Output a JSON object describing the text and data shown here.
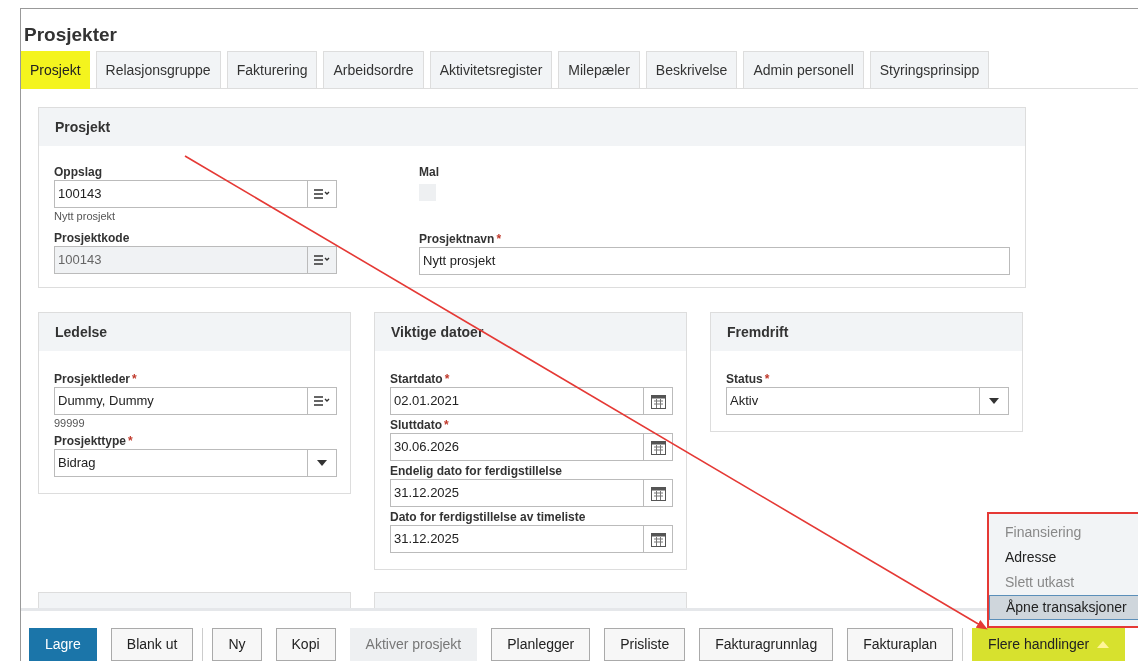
{
  "title": "Prosjekter",
  "tabs": [
    {
      "label": "Prosjekt",
      "selected": true
    },
    {
      "label": "Relasjonsgruppe",
      "selected": false
    },
    {
      "label": "Fakturering",
      "selected": false
    },
    {
      "label": "Arbeidsordre",
      "selected": false
    },
    {
      "label": "Aktivitetsregister",
      "selected": false
    },
    {
      "label": "Milepæler",
      "selected": false
    },
    {
      "label": "Beskrivelse",
      "selected": false
    },
    {
      "label": "Admin personell",
      "selected": false
    },
    {
      "label": "Styringsprinsipp",
      "selected": false
    }
  ],
  "main_panel": {
    "title": "Prosjekt",
    "left": [
      {
        "kind": "lookup",
        "label": "Oppslag",
        "value": "100143",
        "hint": "Nytt prosjekt",
        "disabled": false
      },
      {
        "kind": "lookup",
        "label": "Prosjektkode",
        "value": "100143",
        "disabled": true
      }
    ],
    "right": [
      {
        "kind": "checkbox",
        "label": "Mal",
        "checked": false
      },
      {
        "kind": "text",
        "label": "Prosjektnavn",
        "required_mark": "*",
        "value": "Nytt prosjekt"
      }
    ]
  },
  "panels": [
    {
      "title": "Ledelse",
      "fields": [
        {
          "kind": "lookup",
          "label": "Prosjektleder",
          "required_mark": "*",
          "value": "Dummy, Dummy",
          "hint": "99999",
          "disabled": false
        },
        {
          "kind": "select",
          "label": "Prosjekttype",
          "required_mark": "*",
          "value": "Bidrag"
        }
      ]
    },
    {
      "title": "Viktige datoer",
      "fields": [
        {
          "kind": "date",
          "label": "Startdato",
          "required_mark": "*",
          "value": "02.01.2021"
        },
        {
          "kind": "date",
          "label": "Sluttdato",
          "required_mark": "*",
          "value": "30.06.2026"
        },
        {
          "kind": "date",
          "label": "Endelig dato for ferdigstillelse",
          "value": "31.12.2025"
        },
        {
          "kind": "date",
          "label": "Dato for ferdigstillelse av timeliste",
          "value": "31.12.2025"
        }
      ]
    },
    {
      "title": "Fremdrift",
      "fields": [
        {
          "kind": "select",
          "label": "Status",
          "required_mark": "*",
          "value": "Aktiv"
        }
      ]
    }
  ],
  "toolbar": {
    "groups": [
      [
        {
          "label": "Lagre",
          "kind": "primary"
        },
        {
          "label": "Blank ut",
          "kind": "normal"
        }
      ],
      [
        {
          "label": "Ny",
          "kind": "normal"
        },
        {
          "label": "Kopi",
          "kind": "normal"
        },
        {
          "label": "Aktiver prosjekt",
          "kind": "disabled"
        },
        {
          "label": "Planlegger",
          "kind": "normal"
        },
        {
          "label": "Prisliste",
          "kind": "normal"
        },
        {
          "label": "Fakturagrunnlag",
          "kind": "normal"
        },
        {
          "label": "Fakturaplan",
          "kind": "normal"
        }
      ],
      [
        {
          "label": "Flere handlinger",
          "kind": "highlight",
          "expanded": true
        }
      ]
    ]
  },
  "menu": [
    {
      "label": "Finansiering",
      "disabled": true,
      "selected": false
    },
    {
      "label": "Adresse",
      "disabled": false,
      "selected": false
    },
    {
      "label": "Slett utkast",
      "disabled": true,
      "selected": false
    },
    {
      "label": "Åpne transaksjoner",
      "disabled": false,
      "selected": true
    }
  ]
}
